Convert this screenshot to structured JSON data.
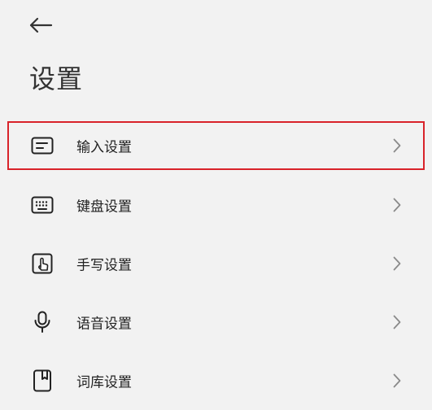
{
  "header": {
    "back_icon": "arrow-left-icon",
    "title": "设置"
  },
  "settings": [
    {
      "label": "输入设置",
      "icon": "input-box-icon",
      "highlighted": true
    },
    {
      "label": "键盘设置",
      "icon": "keyboard-icon",
      "highlighted": false
    },
    {
      "label": "手写设置",
      "icon": "handwriting-icon",
      "highlighted": false
    },
    {
      "label": "语音设置",
      "icon": "microphone-icon",
      "highlighted": false
    },
    {
      "label": "词库设置",
      "icon": "dictionary-icon",
      "highlighted": false
    }
  ],
  "colors": {
    "background": "#f2f2f2",
    "highlight_border": "#d9232a",
    "text": "#222222",
    "chevron": "#8a8a8a"
  }
}
